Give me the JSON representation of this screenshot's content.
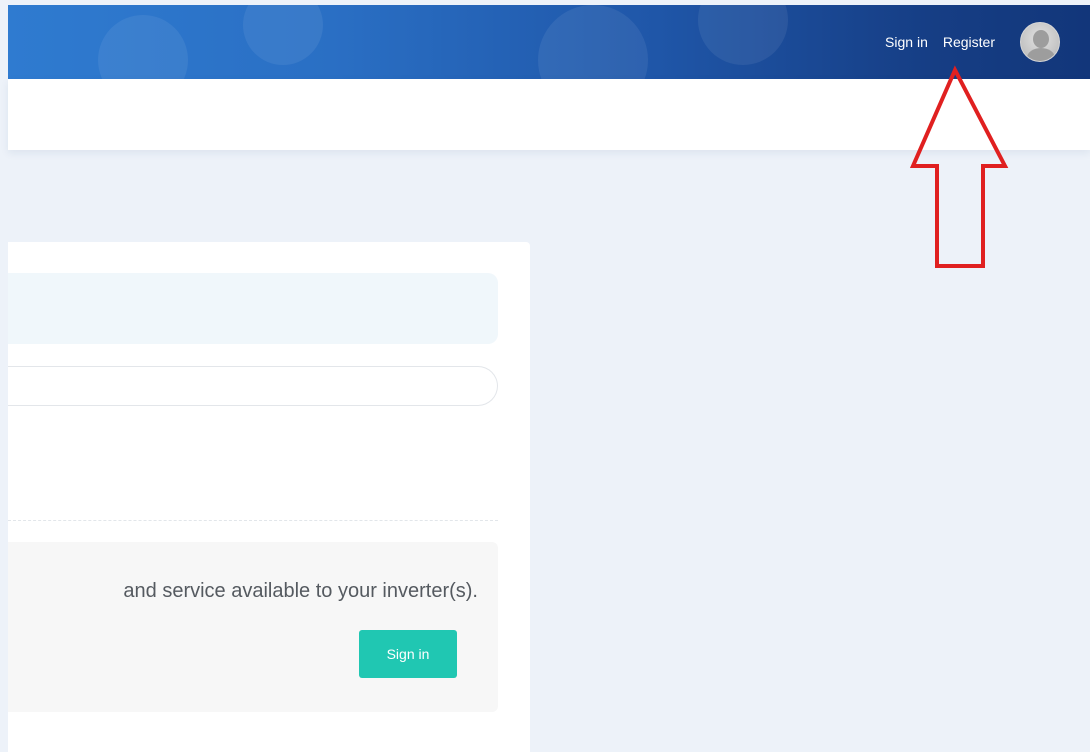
{
  "header": {
    "signin_label": "Sign in",
    "register_label": "Register"
  },
  "main": {
    "search": {
      "placeholder": "",
      "value": ""
    },
    "info_text": "and service available to your inverter(s).",
    "signin_button_label": "Sign in"
  },
  "colors": {
    "header_start": "#2f7bd0",
    "header_end": "#12367a",
    "accent_button": "#20c7b2",
    "page_background": "#edf2f9",
    "annotation_arrow": "#e02020"
  },
  "icons": [
    "avatar-icon",
    "annotation-arrow-icon"
  ]
}
